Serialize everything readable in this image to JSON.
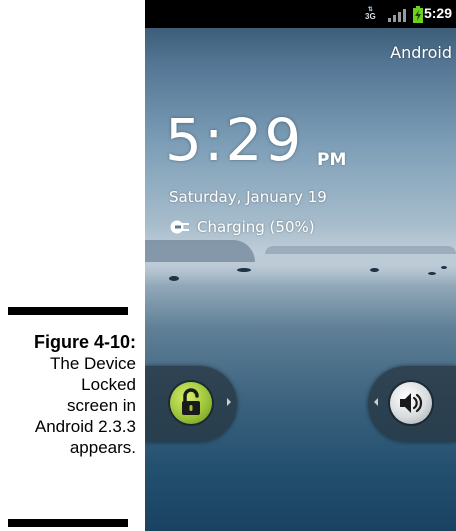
{
  "caption": {
    "title": "Figure 4-10:",
    "lines": [
      "The Device",
      "Locked",
      "screen in",
      "Android 2.3.3",
      "appears."
    ]
  },
  "status_bar": {
    "network_type": "3G",
    "time": "5:29",
    "signal_icon": "signal-bars-icon",
    "battery_icon": "battery-charging-icon"
  },
  "lock_screen": {
    "carrier": "Android",
    "clock": "5:29",
    "ampm": "PM",
    "date": "Saturday, January 19",
    "charging_icon": "charging-plug-icon",
    "charging_text": "Charging (50%)",
    "unlock_icon": "unlock-padlock-icon",
    "sound_icon": "speaker-sound-icon"
  },
  "colors": {
    "unlock_knob": "#9cc53a",
    "status_bar": "#000000",
    "text": "#ffffff"
  }
}
